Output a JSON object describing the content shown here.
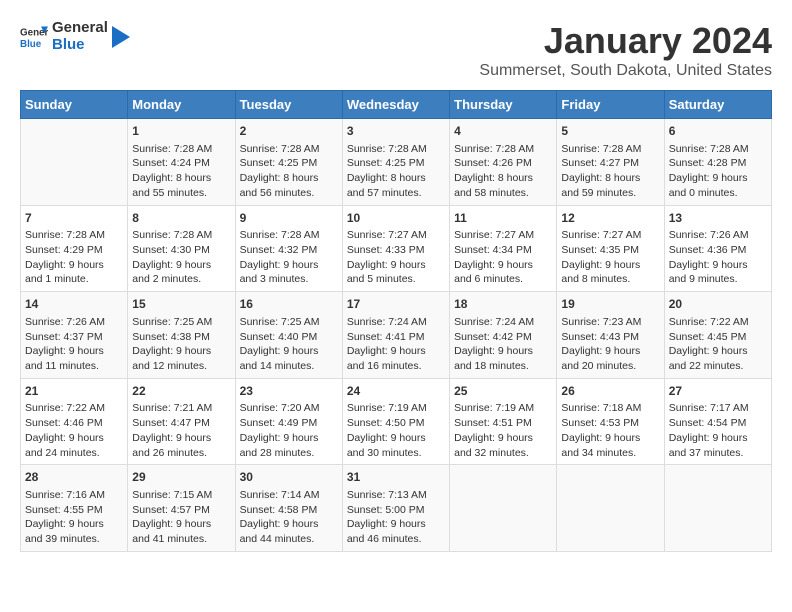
{
  "header": {
    "logo_general": "General",
    "logo_blue": "Blue",
    "title": "January 2024",
    "subtitle": "Summerset, South Dakota, United States"
  },
  "calendar": {
    "days_of_week": [
      "Sunday",
      "Monday",
      "Tuesday",
      "Wednesday",
      "Thursday",
      "Friday",
      "Saturday"
    ],
    "weeks": [
      [
        {
          "day": "",
          "content": ""
        },
        {
          "day": "1",
          "content": "Sunrise: 7:28 AM\nSunset: 4:24 PM\nDaylight: 8 hours\nand 55 minutes."
        },
        {
          "day": "2",
          "content": "Sunrise: 7:28 AM\nSunset: 4:25 PM\nDaylight: 8 hours\nand 56 minutes."
        },
        {
          "day": "3",
          "content": "Sunrise: 7:28 AM\nSunset: 4:25 PM\nDaylight: 8 hours\nand 57 minutes."
        },
        {
          "day": "4",
          "content": "Sunrise: 7:28 AM\nSunset: 4:26 PM\nDaylight: 8 hours\nand 58 minutes."
        },
        {
          "day": "5",
          "content": "Sunrise: 7:28 AM\nSunset: 4:27 PM\nDaylight: 8 hours\nand 59 minutes."
        },
        {
          "day": "6",
          "content": "Sunrise: 7:28 AM\nSunset: 4:28 PM\nDaylight: 9 hours\nand 0 minutes."
        }
      ],
      [
        {
          "day": "7",
          "content": "Sunrise: 7:28 AM\nSunset: 4:29 PM\nDaylight: 9 hours\nand 1 minute."
        },
        {
          "day": "8",
          "content": "Sunrise: 7:28 AM\nSunset: 4:30 PM\nDaylight: 9 hours\nand 2 minutes."
        },
        {
          "day": "9",
          "content": "Sunrise: 7:28 AM\nSunset: 4:32 PM\nDaylight: 9 hours\nand 3 minutes."
        },
        {
          "day": "10",
          "content": "Sunrise: 7:27 AM\nSunset: 4:33 PM\nDaylight: 9 hours\nand 5 minutes."
        },
        {
          "day": "11",
          "content": "Sunrise: 7:27 AM\nSunset: 4:34 PM\nDaylight: 9 hours\nand 6 minutes."
        },
        {
          "day": "12",
          "content": "Sunrise: 7:27 AM\nSunset: 4:35 PM\nDaylight: 9 hours\nand 8 minutes."
        },
        {
          "day": "13",
          "content": "Sunrise: 7:26 AM\nSunset: 4:36 PM\nDaylight: 9 hours\nand 9 minutes."
        }
      ],
      [
        {
          "day": "14",
          "content": "Sunrise: 7:26 AM\nSunset: 4:37 PM\nDaylight: 9 hours\nand 11 minutes."
        },
        {
          "day": "15",
          "content": "Sunrise: 7:25 AM\nSunset: 4:38 PM\nDaylight: 9 hours\nand 12 minutes."
        },
        {
          "day": "16",
          "content": "Sunrise: 7:25 AM\nSunset: 4:40 PM\nDaylight: 9 hours\nand 14 minutes."
        },
        {
          "day": "17",
          "content": "Sunrise: 7:24 AM\nSunset: 4:41 PM\nDaylight: 9 hours\nand 16 minutes."
        },
        {
          "day": "18",
          "content": "Sunrise: 7:24 AM\nSunset: 4:42 PM\nDaylight: 9 hours\nand 18 minutes."
        },
        {
          "day": "19",
          "content": "Sunrise: 7:23 AM\nSunset: 4:43 PM\nDaylight: 9 hours\nand 20 minutes."
        },
        {
          "day": "20",
          "content": "Sunrise: 7:22 AM\nSunset: 4:45 PM\nDaylight: 9 hours\nand 22 minutes."
        }
      ],
      [
        {
          "day": "21",
          "content": "Sunrise: 7:22 AM\nSunset: 4:46 PM\nDaylight: 9 hours\nand 24 minutes."
        },
        {
          "day": "22",
          "content": "Sunrise: 7:21 AM\nSunset: 4:47 PM\nDaylight: 9 hours\nand 26 minutes."
        },
        {
          "day": "23",
          "content": "Sunrise: 7:20 AM\nSunset: 4:49 PM\nDaylight: 9 hours\nand 28 minutes."
        },
        {
          "day": "24",
          "content": "Sunrise: 7:19 AM\nSunset: 4:50 PM\nDaylight: 9 hours\nand 30 minutes."
        },
        {
          "day": "25",
          "content": "Sunrise: 7:19 AM\nSunset: 4:51 PM\nDaylight: 9 hours\nand 32 minutes."
        },
        {
          "day": "26",
          "content": "Sunrise: 7:18 AM\nSunset: 4:53 PM\nDaylight: 9 hours\nand 34 minutes."
        },
        {
          "day": "27",
          "content": "Sunrise: 7:17 AM\nSunset: 4:54 PM\nDaylight: 9 hours\nand 37 minutes."
        }
      ],
      [
        {
          "day": "28",
          "content": "Sunrise: 7:16 AM\nSunset: 4:55 PM\nDaylight: 9 hours\nand 39 minutes."
        },
        {
          "day": "29",
          "content": "Sunrise: 7:15 AM\nSunset: 4:57 PM\nDaylight: 9 hours\nand 41 minutes."
        },
        {
          "day": "30",
          "content": "Sunrise: 7:14 AM\nSunset: 4:58 PM\nDaylight: 9 hours\nand 44 minutes."
        },
        {
          "day": "31",
          "content": "Sunrise: 7:13 AM\nSunset: 5:00 PM\nDaylight: 9 hours\nand 46 minutes."
        },
        {
          "day": "",
          "content": ""
        },
        {
          "day": "",
          "content": ""
        },
        {
          "day": "",
          "content": ""
        }
      ]
    ]
  }
}
